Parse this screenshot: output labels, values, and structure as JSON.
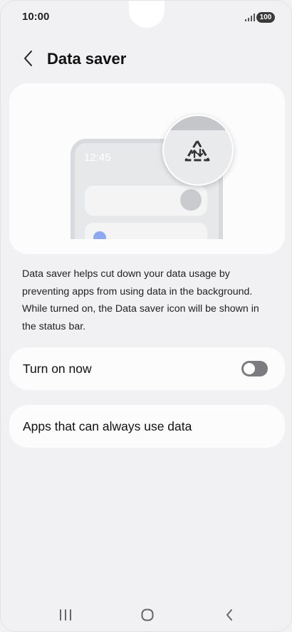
{
  "status_bar": {
    "time": "10:00",
    "battery": "100",
    "icons": [
      "signal-icon",
      "battery-icon"
    ]
  },
  "header": {
    "title": "Data saver",
    "back_icon": "chevron-left-icon"
  },
  "illustration": {
    "mock_time": "12:45",
    "icon": "data-saver-icon"
  },
  "description": "Data saver helps cut down your data usage by preventing apps from using data in the background. While turned on, the Data saver icon will be shown in the status bar.",
  "settings": {
    "turn_on_label": "Turn on now",
    "turn_on_state": false,
    "apps_label": "Apps that can always use data"
  },
  "nav_bar": {
    "icons": [
      "recents-icon",
      "home-icon",
      "back-icon"
    ]
  },
  "colors": {
    "background": "#f1f1f3",
    "card": "#fcfcfd",
    "toggle_off": "#7c7c80",
    "accent_dot": "#8ea8f0"
  }
}
